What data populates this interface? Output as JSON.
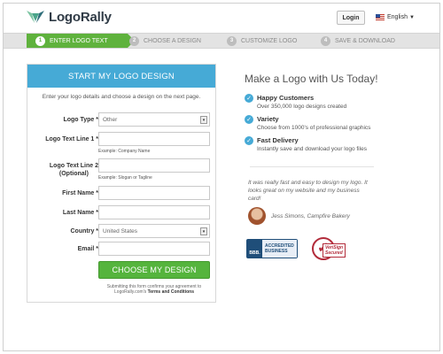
{
  "brand": {
    "name_part1": "Logo",
    "name_part2": "Rally"
  },
  "header": {
    "login_label": "Login",
    "language": "English"
  },
  "steps": [
    {
      "num": "1",
      "label": "ENTER LOGO TEXT"
    },
    {
      "num": "2",
      "label": "CHOOSE A DESIGN"
    },
    {
      "num": "3",
      "label": "CUSTOMIZE LOGO"
    },
    {
      "num": "4",
      "label": "SAVE & DOWNLOAD"
    }
  ],
  "form": {
    "title": "START MY LOGO DESIGN",
    "subtitle": "Enter your logo details and choose a design on the next page.",
    "logo_type_label": "Logo Type *",
    "logo_type_value": "Other",
    "text1_label": "Logo Text Line 1 *",
    "text1_hint": "Example: Company Name",
    "text2_label_a": "Logo Text Line 2",
    "text2_label_b": "(Optional)",
    "text2_hint": "Example: Slogan or Tagline",
    "first_name_label": "First Name *",
    "last_name_label": "Last Name *",
    "country_label": "Country *",
    "country_value": "United States",
    "email_label": "Email *",
    "submit_label": "CHOOSE MY DESIGN",
    "legal_text": "Submitting this form confirms your agreement to LogoRally.com's",
    "legal_link": "Terms and Conditions"
  },
  "pitch": {
    "title": "Make a Logo with Us Today!",
    "benefits": [
      {
        "title": "Happy Customers",
        "text": "Over 350,000 logo designs created"
      },
      {
        "title": "Variety",
        "text": "Choose from 1000's of professional graphics"
      },
      {
        "title": "Fast Delivery",
        "text": "Instantly save and download your logo files"
      }
    ],
    "quote": "It was really fast and easy to design my logo. It looks great on my website and my business card!",
    "author": "Jess Simons, Campfire Bakery"
  },
  "badges": {
    "bbb_short": "BBB.",
    "bbb_line1": "ACCREDITED",
    "bbb_line2": "BUSINESS",
    "verisign_line1": "VeriSign",
    "verisign_line2": "Secured"
  },
  "colors": {
    "accent_blue": "#46aad6",
    "accent_green": "#5fb23d"
  }
}
